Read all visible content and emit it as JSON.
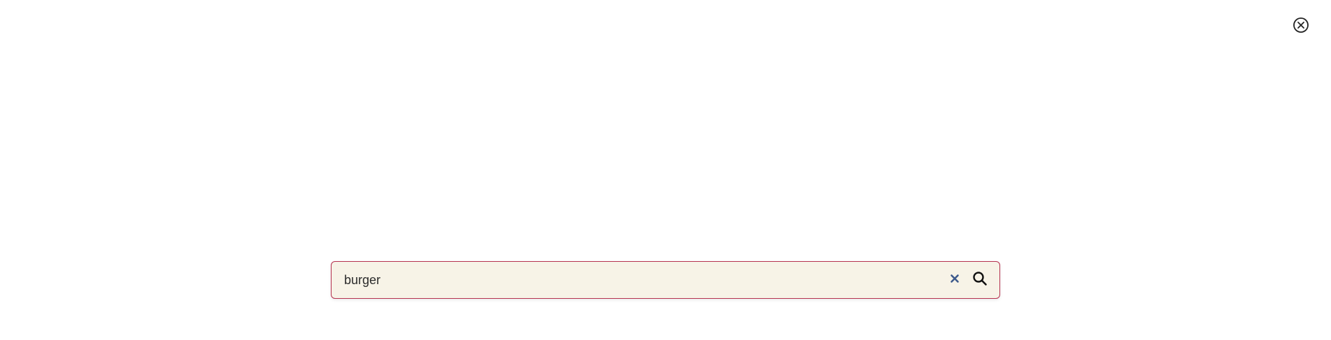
{
  "search": {
    "value": "burger",
    "clear_icon": "close-x-icon",
    "submit_icon": "search-icon",
    "border_color": "#b5314e",
    "background_color": "#f7f3e7",
    "clear_icon_color": "#3d5a8c"
  },
  "overlay": {
    "close_icon": "circle-close-icon"
  }
}
